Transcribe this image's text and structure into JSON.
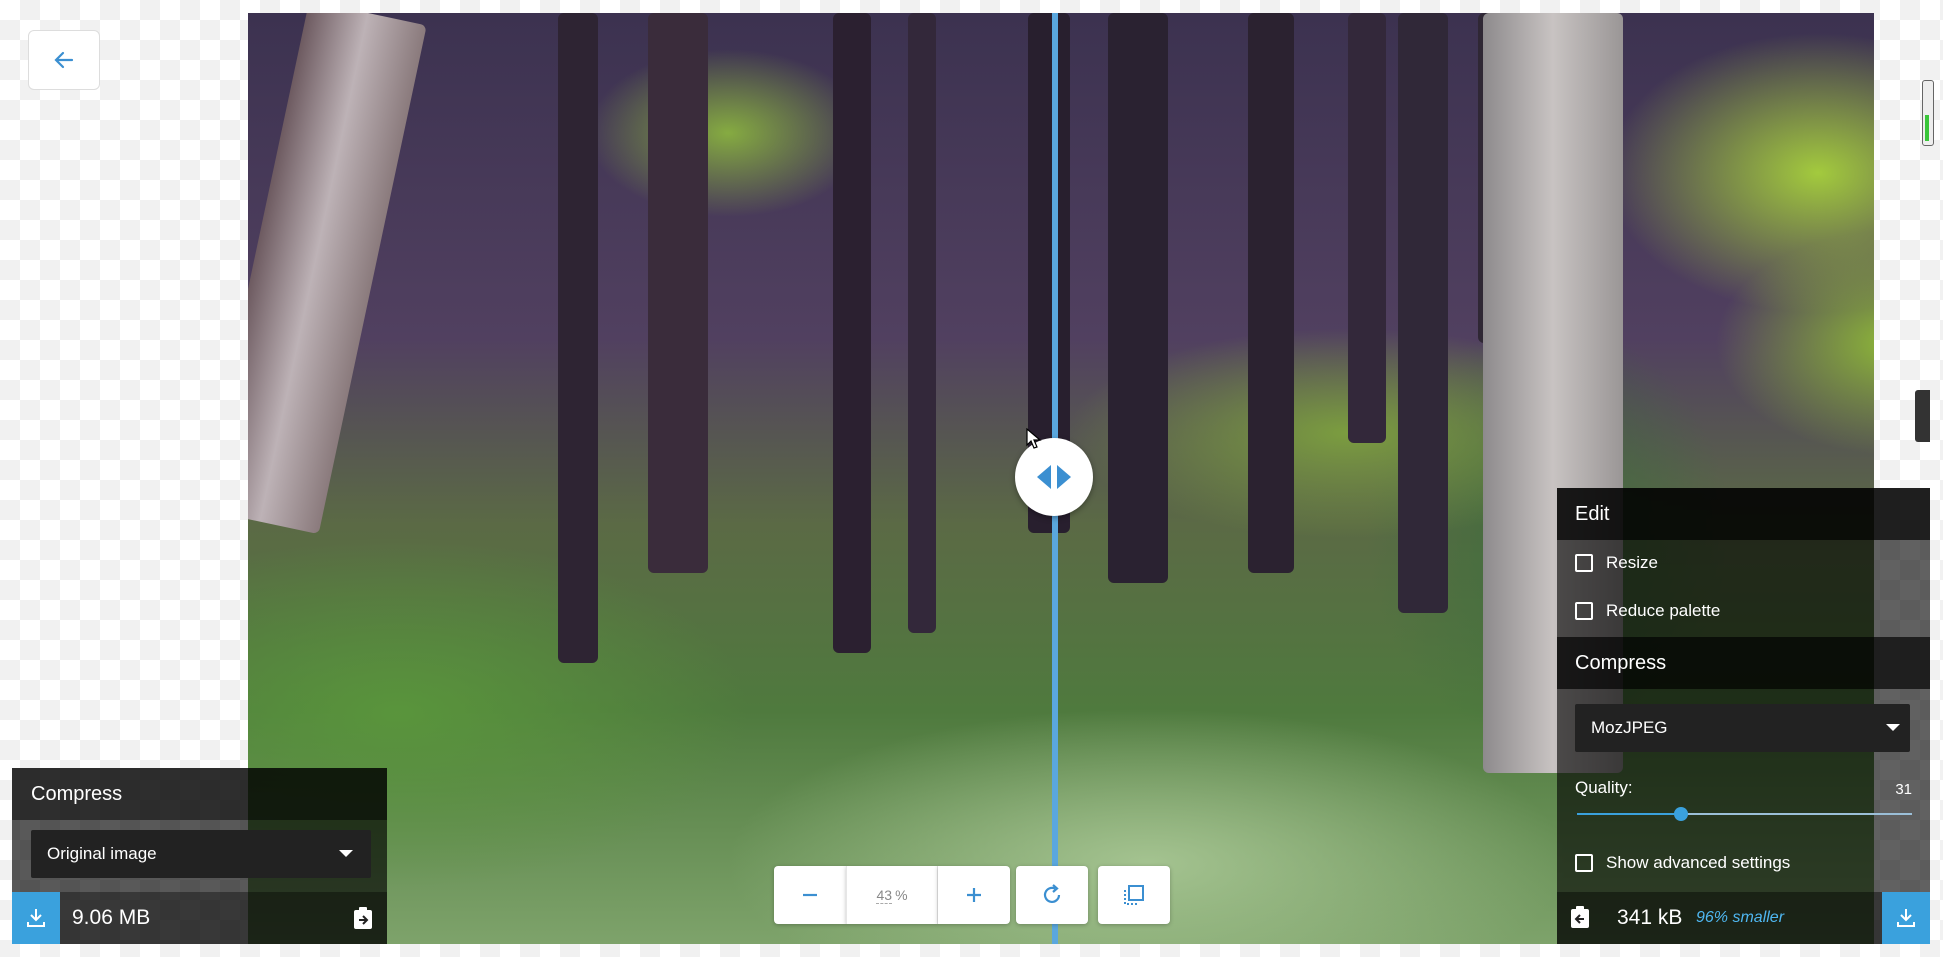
{
  "left_panel": {
    "title": "Compress",
    "select_value": "Original image",
    "file_size": "9.06 MB",
    "download_icon": "download-icon",
    "copy_icon": "copy-to-other-side-icon"
  },
  "right_panel": {
    "edit_title": "Edit",
    "resize_label": "Resize",
    "reduce_palette_label": "Reduce palette",
    "compress_title": "Compress",
    "codec_value": "MozJPEG",
    "quality_label": "Quality:",
    "quality_value": "31",
    "quality_fraction": 0.31,
    "advanced_label": "Show advanced settings",
    "file_size": "341 kB",
    "savings": "96% smaller"
  },
  "toolbar": {
    "zoom_value": "43",
    "zoom_unit": "%",
    "zoom_out_icon": "minus-icon",
    "zoom_in_icon": "plus-icon",
    "rotate_icon": "rotate-icon",
    "background_icon": "toggle-background-icon"
  },
  "colors": {
    "accent": "#3aa1dd",
    "divider": "#5aa7de"
  }
}
